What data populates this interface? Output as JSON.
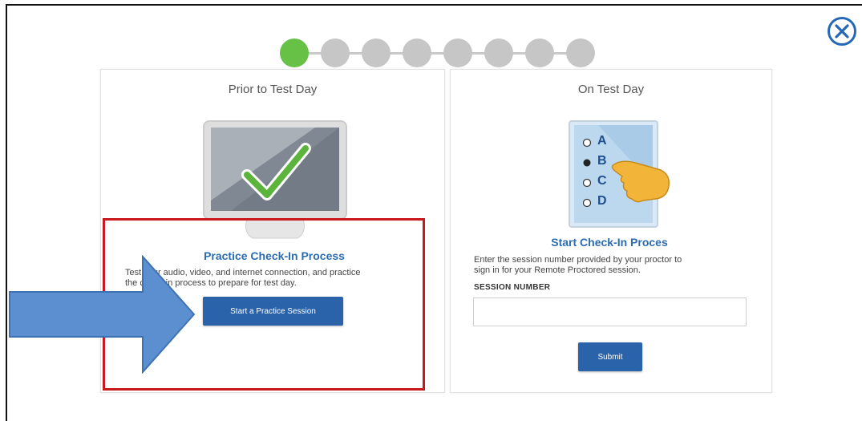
{
  "progress": {
    "total_steps": 8,
    "current_step": 1
  },
  "left_panel": {
    "title": "Prior to Test Day",
    "heading": "Practice Check-In Process",
    "description_line1": "Test your audio, video, and internet connection, and practice",
    "description_line2": "the check-in process to prepare for test day.",
    "button_label": "Start a Practice Session"
  },
  "right_panel": {
    "title": "On Test Day",
    "heading": "Start Check-In Proces",
    "description_line1": "Enter the session number provided by your proctor to",
    "description_line2": "sign in for your Remote Proctored session.",
    "session_label": "SESSION NUMBER",
    "session_value": "",
    "button_label": "Submit"
  },
  "quiz_options": [
    "A",
    "B",
    "C",
    "D"
  ],
  "selected_option": "B",
  "colors": {
    "accent_blue": "#2b63aa",
    "heading_blue": "#2b6cb0",
    "active_step": "#66c146",
    "highlight_red": "#c8191c",
    "arrow_blue": "#5b8fd0"
  },
  "icons": {
    "close": "close-circle-icon",
    "monitor": "monitor-checkmark-icon",
    "quiz": "quiz-card-hand-icon",
    "arrow": "arrow-right-icon"
  }
}
